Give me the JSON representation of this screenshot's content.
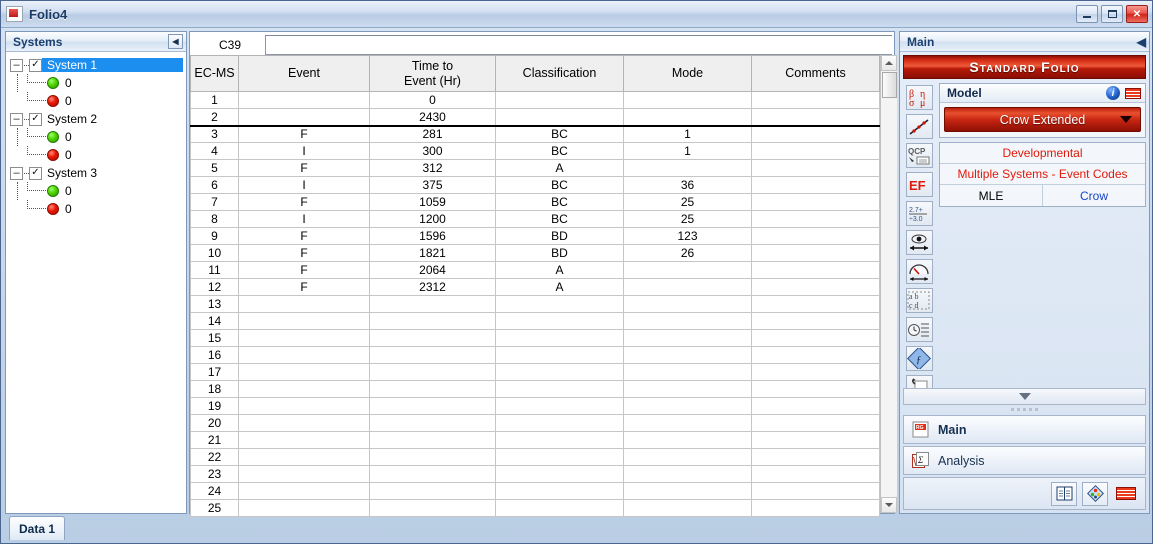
{
  "window": {
    "title": "Folio4",
    "app_icon": "rga-logo-icon",
    "minimize_label": "_",
    "maximize_label": "□",
    "close_label": "✕"
  },
  "systems_panel": {
    "header": "Systems",
    "collapse_icon": "collapse-left-icon",
    "nodes": [
      {
        "label": "System 1",
        "selected": true,
        "checked": true,
        "green_count": "0",
        "red_count": "0"
      },
      {
        "label": "System 2",
        "selected": false,
        "checked": true,
        "green_count": "0",
        "red_count": "0"
      },
      {
        "label": "System 3",
        "selected": false,
        "checked": true,
        "green_count": "0",
        "red_count": "0"
      }
    ],
    "expander_glyph": "–",
    "check_glyph": "✓"
  },
  "sheet": {
    "cell_reference": "C39",
    "formula_value": "",
    "columns": [
      "EC-MS",
      "Event",
      "Time to\nEvent (Hr)",
      "Classification",
      "Mode",
      "Comments"
    ],
    "columns_flat": [
      "EC-MS",
      "Event",
      "Time to Event (Hr)",
      "Classification",
      "Mode",
      "Comments"
    ],
    "rows": [
      {
        "n": "1",
        "event": "",
        "time": "0",
        "classification": "",
        "mode": "",
        "comments": "",
        "shaded": true
      },
      {
        "n": "2",
        "event": "",
        "time": "2430",
        "classification": "",
        "mode": "",
        "comments": "",
        "shaded": true,
        "separator": true
      },
      {
        "n": "3",
        "event": "F",
        "time": "281",
        "classification": "BC",
        "mode": "1",
        "comments": ""
      },
      {
        "n": "4",
        "event": "I",
        "time": "300",
        "classification": "BC",
        "mode": "1",
        "comments": ""
      },
      {
        "n": "5",
        "event": "F",
        "time": "312",
        "classification": "A",
        "mode": "",
        "comments": ""
      },
      {
        "n": "6",
        "event": "I",
        "time": "375",
        "classification": "BC",
        "mode": "36",
        "comments": ""
      },
      {
        "n": "7",
        "event": "F",
        "time": "1059",
        "classification": "BC",
        "mode": "25",
        "comments": ""
      },
      {
        "n": "8",
        "event": "I",
        "time": "1200",
        "classification": "BC",
        "mode": "25",
        "comments": ""
      },
      {
        "n": "9",
        "event": "F",
        "time": "1596",
        "classification": "BD",
        "mode": "123",
        "comments": ""
      },
      {
        "n": "10",
        "event": "F",
        "time": "1821",
        "classification": "BD",
        "mode": "26",
        "comments": ""
      },
      {
        "n": "11",
        "event": "F",
        "time": "2064",
        "classification": "A",
        "mode": "",
        "comments": ""
      },
      {
        "n": "12",
        "event": "F",
        "time": "2312",
        "classification": "A",
        "mode": "",
        "comments": ""
      },
      {
        "n": "13",
        "event": "",
        "time": "",
        "classification": "",
        "mode": "",
        "comments": ""
      },
      {
        "n": "14",
        "event": "",
        "time": "",
        "classification": "",
        "mode": "",
        "comments": ""
      },
      {
        "n": "15",
        "event": "",
        "time": "",
        "classification": "",
        "mode": "",
        "comments": ""
      },
      {
        "n": "16",
        "event": "",
        "time": "",
        "classification": "",
        "mode": "",
        "comments": ""
      },
      {
        "n": "17",
        "event": "",
        "time": "",
        "classification": "",
        "mode": "",
        "comments": ""
      },
      {
        "n": "18",
        "event": "",
        "time": "",
        "classification": "",
        "mode": "",
        "comments": ""
      },
      {
        "n": "19",
        "event": "",
        "time": "",
        "classification": "",
        "mode": "",
        "comments": ""
      },
      {
        "n": "20",
        "event": "",
        "time": "",
        "classification": "",
        "mode": "",
        "comments": ""
      },
      {
        "n": "21",
        "event": "",
        "time": "",
        "classification": "",
        "mode": "",
        "comments": ""
      },
      {
        "n": "22",
        "event": "",
        "time": "",
        "classification": "",
        "mode": "",
        "comments": ""
      },
      {
        "n": "23",
        "event": "",
        "time": "",
        "classification": "",
        "mode": "",
        "comments": ""
      },
      {
        "n": "24",
        "event": "",
        "time": "",
        "classification": "",
        "mode": "",
        "comments": ""
      },
      {
        "n": "25",
        "event": "",
        "time": "",
        "classification": "",
        "mode": "",
        "comments": ""
      }
    ]
  },
  "sheet_tabs": {
    "tabs": [
      {
        "label": "Data 1",
        "active": true
      }
    ]
  },
  "right_panel": {
    "header": "Main",
    "collapse_icon": "collapse-left-icon",
    "banner": "Standard Folio",
    "model_card": {
      "title": "Model",
      "info_icon": "info-icon",
      "redlines_icon": "redlines-icon",
      "selected_model": "Crow Extended",
      "dropdown_icon": "chevron-down-icon"
    },
    "info_rows": {
      "data_type": "Developmental",
      "data_source": "Multiple Systems - Event Codes",
      "analysis_method": "MLE",
      "model_family": "Crow"
    },
    "icon_rail": [
      "beta-eta-sigma-mu-icon",
      "scatter-trendline-icon",
      "qcp-icon",
      "ef-icon",
      "convert-units-icon",
      "watch-results-icon",
      "gauge-icon",
      "abc-transpose-icon",
      "clock-list-icon",
      "plot-setup-icon",
      "page-curl-icon",
      "weibull-pen-icon"
    ],
    "collapse_strip_icon": "chevron-down-icon",
    "nav_items": [
      {
        "label": "Main",
        "icon": "rga-main-icon",
        "active": true
      },
      {
        "label": "Analysis",
        "icon": "analysis-icon",
        "active": false
      }
    ],
    "footer_icons": [
      "report-icon",
      "plot-icon",
      "redlines-icon"
    ]
  },
  "colors": {
    "accent_red": "#e01b0b",
    "banner_red": "#c72512",
    "link_blue": "#1746c8",
    "selection_blue": "#1c8ef0",
    "title_blue": "#1b3f6e",
    "led_green": "#4fd400",
    "led_red": "#e81500"
  }
}
